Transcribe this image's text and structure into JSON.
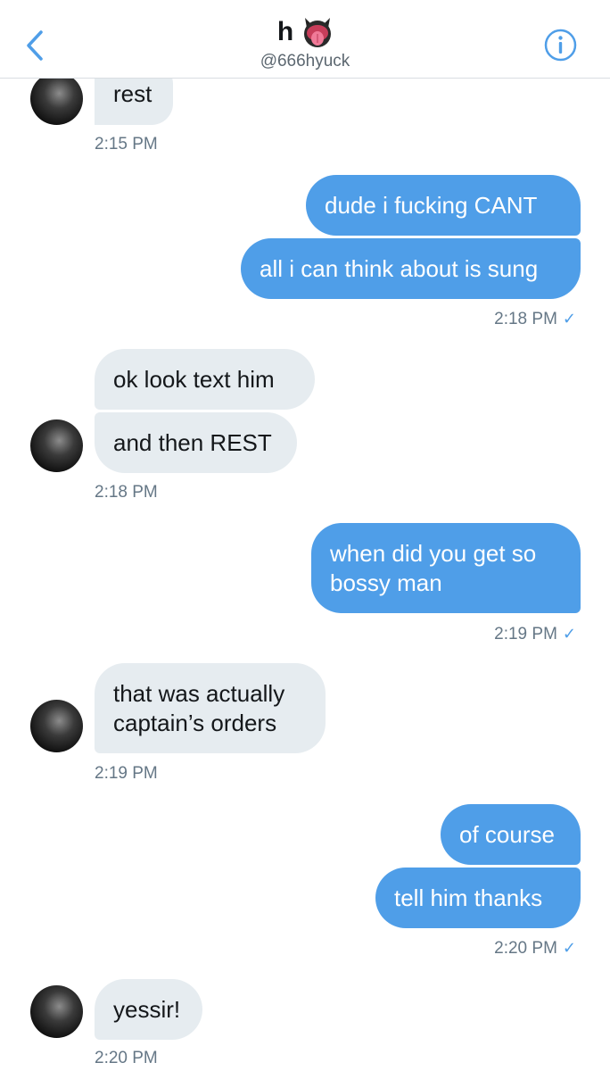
{
  "header": {
    "title": "h",
    "handle": "@666hyuck"
  },
  "colors": {
    "sent_bubble": "#4f9ee8",
    "received_bubble": "#e6ecf0",
    "accent": "#4f9ee8"
  },
  "icons": {
    "back": "chevron-left-icon",
    "info": "info-circle-icon",
    "title_emoji": "tongue-face-emoji",
    "read": "checkmark-icon"
  },
  "messages": [
    {
      "from": "them",
      "text": "rest"
    },
    {
      "from": "them",
      "time": "2:15 PM"
    },
    {
      "from": "me",
      "text": "dude i fucking CANT"
    },
    {
      "from": "me",
      "text": "all i can think about is sung",
      "time": "2:18 PM",
      "read": true
    },
    {
      "from": "them",
      "text": "ok look text him"
    },
    {
      "from": "them",
      "text": "and then REST",
      "time": "2:18 PM"
    },
    {
      "from": "me",
      "text": "when did you get so bossy man",
      "time": "2:19 PM",
      "read": true
    },
    {
      "from": "them",
      "text": "that was actually captain’s orders",
      "time": "2:19 PM"
    },
    {
      "from": "me",
      "text": "of course"
    },
    {
      "from": "me",
      "text": "tell him thanks",
      "time": "2:20 PM",
      "read": true
    },
    {
      "from": "them",
      "text": "yessir!",
      "time": "2:20 PM"
    }
  ],
  "read_mark": "✓"
}
